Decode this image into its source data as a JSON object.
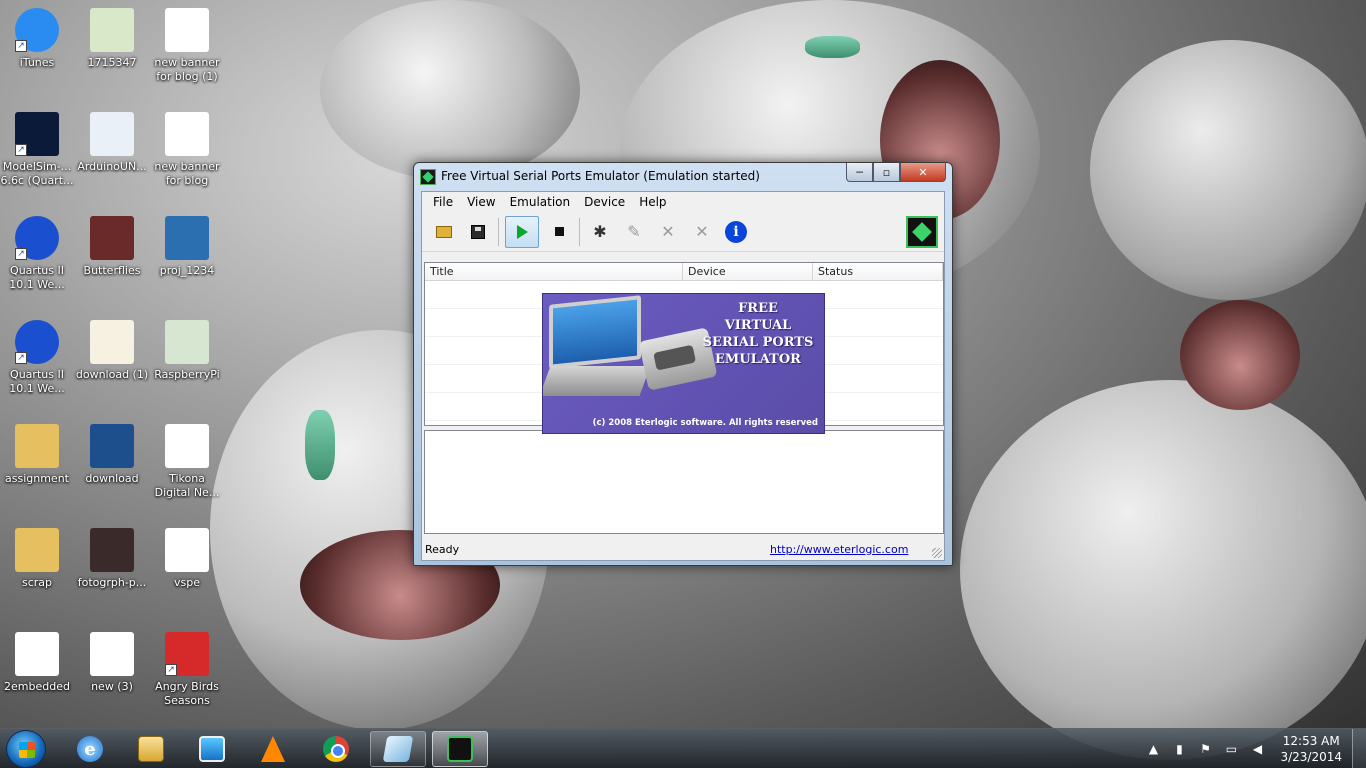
{
  "desktop": {
    "icons": [
      {
        "label": "iTunes",
        "icon": "itunes-icon",
        "color": "#2a8cf0"
      },
      {
        "label": "1715347",
        "icon": "image-file-icon",
        "color": "#d9e8c9"
      },
      {
        "label": "new banner for blog (1)",
        "icon": "image-file-icon",
        "color": "#ffffff"
      },
      {
        "label": "ModelSim-... 6.6c (Quart...",
        "icon": "modelsim-icon",
        "color": "#0c1a3a"
      },
      {
        "label": "ArduinoUN...",
        "icon": "image-file-icon",
        "color": "#e9f0f7"
      },
      {
        "label": "new banner for blog",
        "icon": "image-file-icon",
        "color": "#ffffff"
      },
      {
        "label": "Quartus II 10.1 We...",
        "icon": "quartus-icon",
        "color": "#1a4fd0"
      },
      {
        "label": "Butterflies",
        "icon": "image-file-icon",
        "color": "#6a2a2a"
      },
      {
        "label": "proj_1234",
        "icon": "image-file-icon",
        "color": "#2c6fb0"
      },
      {
        "label": "Quartus II 10.1 We...",
        "icon": "quartus-icon",
        "color": "#1a4fd0"
      },
      {
        "label": "download (1)",
        "icon": "image-file-icon",
        "color": "#f6f1e0"
      },
      {
        "label": "RaspberryPi",
        "icon": "image-file-icon",
        "color": "#d6e6d0"
      },
      {
        "label": "assignment",
        "icon": "folder-icon",
        "color": "#e6c060"
      },
      {
        "label": "download",
        "icon": "image-file-icon",
        "color": "#1c4f8c"
      },
      {
        "label": "Tikona Digital Ne...",
        "icon": "document-icon",
        "color": "#ffffff"
      },
      {
        "label": "scrap",
        "icon": "folder-icon",
        "color": "#e6c060"
      },
      {
        "label": "fotogrph-p...",
        "icon": "image-file-icon",
        "color": "#3a2a2a"
      },
      {
        "label": "vspe",
        "icon": "text-file-icon",
        "color": "#ffffff"
      },
      {
        "label": "2embedded",
        "icon": "image-file-icon",
        "color": "#ffffff"
      },
      {
        "label": "new (3)",
        "icon": "image-file-icon",
        "color": "#ffffff"
      },
      {
        "label": "Angry Birds Seasons",
        "icon": "angry-birds-icon",
        "color": "#d62a2a"
      }
    ]
  },
  "window": {
    "title": "Free Virtual Serial Ports Emulator (Emulation started)",
    "controls": {
      "minimize": "─",
      "maximize": "▫",
      "close": "✕"
    },
    "menu": [
      "File",
      "View",
      "Emulation",
      "Device",
      "Help"
    ],
    "toolbar": {
      "open_icon": "folder-open-icon",
      "save_icon": "save-icon",
      "start_icon": "play-icon",
      "stop_icon": "stop-icon",
      "info_glyph": "i"
    },
    "columns": [
      "Title",
      "Device",
      "Status"
    ],
    "splash": {
      "title_lines": [
        "FREE",
        "VIRTUAL",
        "SERIAL PORTS",
        "EMULATOR"
      ],
      "copyright": "(c) 2008 Eterlogic software. All rights reserved"
    },
    "status": {
      "text": "Ready",
      "link": "http://www.eterlogic.com"
    }
  },
  "taskbar": {
    "clock_time": "12:53 AM",
    "clock_date": "3/23/2014",
    "tray_expand": "▲",
    "apps": [
      {
        "name": "internet-explorer",
        "label": "e"
      },
      {
        "name": "windows-explorer"
      },
      {
        "name": "windows-media-player"
      },
      {
        "name": "vlc-player"
      },
      {
        "name": "google-chrome"
      },
      {
        "name": "glass-app",
        "running": true
      },
      {
        "name": "serial-ports-emulator",
        "running": true,
        "active": true
      }
    ]
  }
}
